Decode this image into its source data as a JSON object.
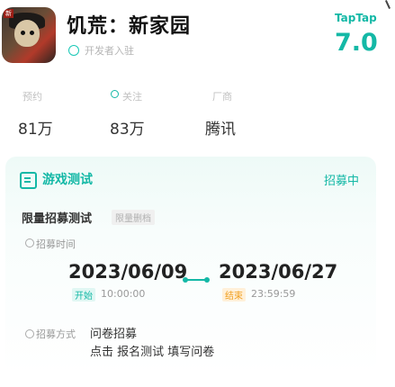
{
  "header": {
    "app_title": "饥荒：新家园",
    "publisher_text": "开发者入驻",
    "brand": "TapTap",
    "rating": "7.0",
    "icon_tag": "新"
  },
  "stats": [
    {
      "label": "预约",
      "value": "81万"
    },
    {
      "label": "关注",
      "value": "83万"
    },
    {
      "label": "厂商",
      "value": "腾讯"
    }
  ],
  "test_card": {
    "section_title": "游戏测试",
    "status": "招募中",
    "test_name": "限量招募测试",
    "test_badge": "限量删档",
    "time_label": "招募时间",
    "start_date": "2023/06/09",
    "end_date": "2023/06/27",
    "start_tag": "开始",
    "start_time": "10:00:00",
    "end_tag": "结束",
    "end_time": "23:59:59",
    "recruit_label": "招募方式",
    "recruit_value": "问卷招募",
    "recruit_hint": "点击 报名测试 填写问卷"
  },
  "colors": {
    "accent": "#14b8a6",
    "end_tag": "#f0a020"
  }
}
